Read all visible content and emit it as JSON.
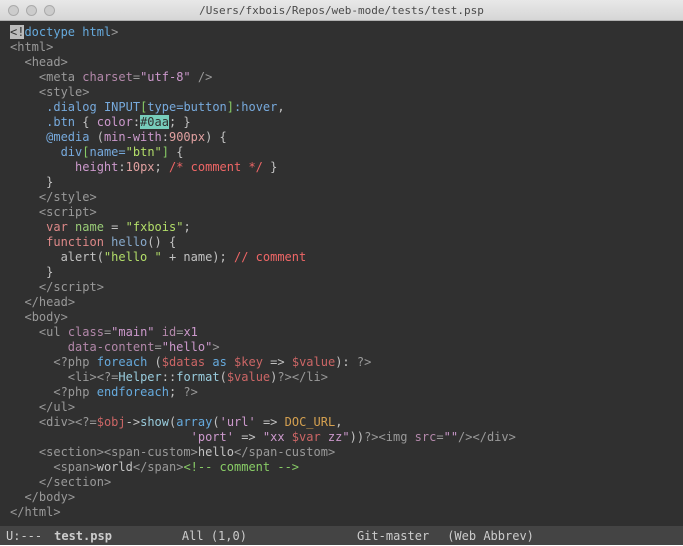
{
  "window": {
    "title": "/Users/fxbois/Repos/web-mode/tests/test.psp"
  },
  "modeline": {
    "left": "U:---",
    "file": "test.psp",
    "pos": "All (1,0)",
    "vc": "Git-master",
    "modes": "(Web Abbrev)"
  },
  "code": {
    "l01a": "<!",
    "l01b": "doctype html",
    "l01c": ">",
    "l02a": "<",
    "l02b": "html",
    "l02c": ">",
    "l03a": "  <",
    "l03b": "head",
    "l03c": ">",
    "l04a": "    <",
    "l04b": "meta",
    "l04sp": " ",
    "l04c": "charset",
    "l04d": "=",
    "l04e": "\"utf-8\"",
    "l04f": " />",
    "l05a": "    <",
    "l05b": "style",
    "l05c": ">",
    "l06a": "     ",
    "l06b": ".dialog",
    "l06c": " ",
    "l06d": "INPUT",
    "l06e": "[",
    "l06f": "type",
    "l06g": "=",
    "l06h": "button",
    "l06i": "]",
    "l06j": ":hover",
    "l06k": ",",
    "l07a": "     ",
    "l07b": ".btn",
    "l07c": " { ",
    "l07d": "color",
    "l07e": ":",
    "l07f": "#0aa",
    "l07g": "; }",
    "l08a": "     ",
    "l08b": "@media",
    "l08c": " (",
    "l08d": "min-with",
    "l08e": ":",
    "l08f": "900px",
    "l08g": ") {",
    "l09a": "       ",
    "l09b": "div",
    "l09c": "[",
    "l09d": "name",
    "l09e": "=",
    "l09f": "\"btn\"",
    "l09g": "]",
    "l09h": " {",
    "l10a": "         ",
    "l10b": "height",
    "l10c": ":",
    "l10d": "10px",
    "l10e": "; ",
    "l10f": "/* comment */",
    "l10g": " }",
    "l11a": "     }",
    "l12a": "    </",
    "l12b": "style",
    "l12c": ">",
    "l13a": "    <",
    "l13b": "script",
    "l13c": ">",
    "l14a": "     ",
    "l14b": "var",
    "l14c": " ",
    "l14d": "name",
    "l14e": " = ",
    "l14f": "\"fxbois\"",
    "l14g": ";",
    "l15a": "     ",
    "l15b": "function",
    "l15c": " ",
    "l15d": "hello",
    "l15e": "()",
    " l15f": " {",
    "l16a": "       alert(",
    "l16b": "\"hello \"",
    "l16c": " + name); ",
    "l16d": "// comment",
    "l17a": "     }",
    "l18a": "    </",
    "l18b": "script",
    "l18c": ">",
    "l19a": "  </",
    "l19b": "head",
    "l19c": ">",
    "l20a": "  <",
    "l20b": "body",
    "l20c": ">",
    "l21a": "    <",
    "l21b": "ul",
    "l21sp": " ",
    "l21c": "class",
    "l21d": "=",
    "l21e": "\"main\"",
    "l21f": " ",
    "l21g": "id",
    "l21h": "=",
    "l21i": "x1",
    "l22a": "        ",
    "l22b": "data-content",
    "l22c": "=",
    "l22d": "\"hello\"",
    "l22e": ">",
    "l23a": "      <?",
    "l23b": "php",
    "l23c": " ",
    "l23d": "foreach",
    "l23e": " (",
    "l23f": "$datas",
    "l23g": " ",
    "l23h": "as",
    "l23i": " ",
    "l23j": "$key",
    "l23k": " => ",
    "l23l": "$value",
    "l23m": "): ",
    "l23n": "?>",
    "l24a": "        <",
    "l24b": "li",
    "l24c": ">",
    "l24d": "<?=",
    "l24e": "Helper",
    "l24f": "::",
    "l24g": "format",
    "l24h": "(",
    "l24i": "$value",
    "l24j": ")",
    "l24k": "?>",
    "l24l": "</",
    "l24m": "li",
    "l24n": ">",
    "l25a": "      <?",
    "l25b": "php",
    "l25c": " ",
    "l25d": "endforeach",
    "l25e": "; ",
    "l25f": "?>",
    "l26a": "    </",
    "l26b": "ul",
    "l26c": ">",
    "l27a": "    <",
    "l27b": "div",
    "l27c": ">",
    "l27d": "<?=",
    "l27e": "$obj",
    "l27f": "->",
    "l27g": "show",
    "l27h": "(",
    "l27i": "array",
    "l27j": "(",
    "l27k": "'url'",
    "l27l": " => ",
    "l27m": "DOC_URL",
    "l27n": ",",
    "l28a": "                         ",
    "l28b": "'port'",
    "l28c": " => ",
    "l28d": "\"xx ",
    "l28e": "$var",
    "l28f": " zz\"",
    "l28g": "))",
    "l28h": "?>",
    "l28i": "<",
    "l28j": "img",
    "l28sp": " ",
    "l28k": "src",
    "l28l": "=",
    "l28m": "\"\"",
    "l28n": "/></",
    "l28o": "div",
    "l28p": ">",
    "l29a": "    <",
    "l29b": "section",
    "l29c": "><",
    "l29d": "span-custom",
    "l29e": ">",
    "l29f": "hello",
    "l29g": "</",
    "l29h": "span-custom",
    "l29i": ">",
    "l30a": "      <",
    "l30b": "span",
    "l30c": ">",
    "l30d": "world",
    "l30e": "</",
    "l30f": "span",
    "l30g": ">",
    "l30h": "<!-- comment -->",
    "l31a": "    </",
    "l31b": "section",
    "l31c": ">",
    "l32a": "  </",
    "l32b": "body",
    "l32c": ">",
    "l33a": "</",
    "l33b": "html",
    "l33c": ">"
  }
}
